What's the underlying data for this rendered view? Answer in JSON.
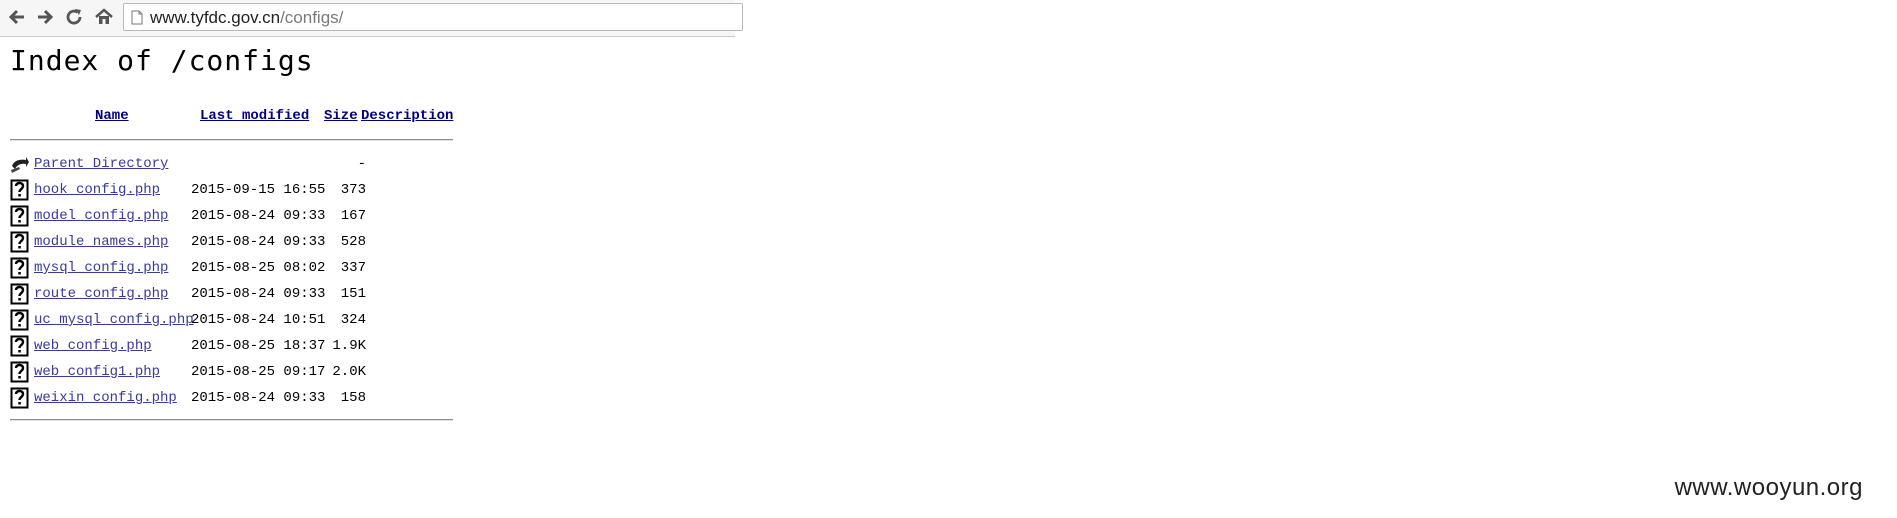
{
  "browser": {
    "url_host": "www.tyfdc.gov.cn",
    "url_path": "/configs/"
  },
  "page": {
    "title": "Index of /configs"
  },
  "table": {
    "headers": {
      "name": "Name",
      "modified": "Last modified",
      "size": "Size",
      "description": "Description"
    },
    "parent": {
      "name": "Parent Directory",
      "size": "-"
    },
    "files": [
      {
        "name": "hook_config.php",
        "modified": "2015-09-15 16:55",
        "size": "373"
      },
      {
        "name": "model_config.php",
        "modified": "2015-08-24 09:33",
        "size": "167"
      },
      {
        "name": "module_names.php",
        "modified": "2015-08-24 09:33",
        "size": "528"
      },
      {
        "name": "mysql_config.php",
        "modified": "2015-08-25 08:02",
        "size": "337"
      },
      {
        "name": "route_config.php",
        "modified": "2015-08-24 09:33",
        "size": "151"
      },
      {
        "name": "uc_mysql_config.php",
        "modified": "2015-08-24 10:51",
        "size": "324"
      },
      {
        "name": "web_config.php",
        "modified": "2015-08-25 18:37",
        "size": "1.9K"
      },
      {
        "name": "web_config1.php",
        "modified": "2015-08-25 09:17",
        "size": "2.0K"
      },
      {
        "name": "weixin_config.php",
        "modified": "2015-08-24 09:33",
        "size": "158"
      }
    ]
  },
  "watermark": "www.wooyun.org",
  "icons": {
    "parent": "back-arrow-icon",
    "file": "unknown-file-icon"
  }
}
